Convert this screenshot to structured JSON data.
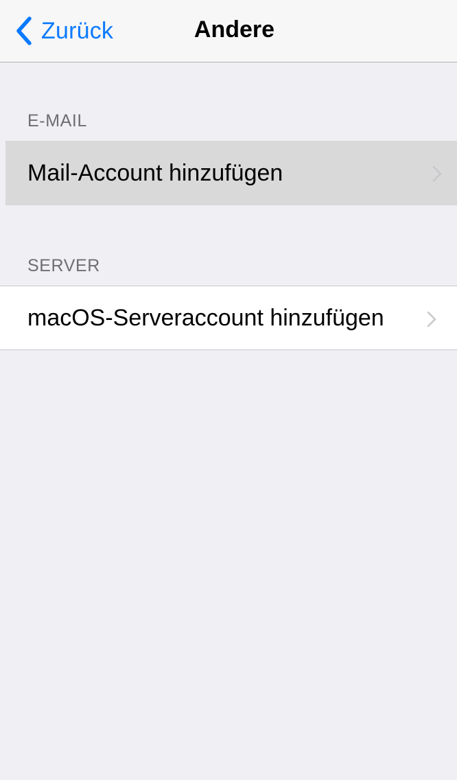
{
  "navbar": {
    "back_label": "Zurück",
    "title": "Andere"
  },
  "sections": [
    {
      "header": "E-MAIL",
      "rows": [
        {
          "label": "Mail-Account hinzufügen",
          "selected": true
        }
      ]
    },
    {
      "header": "SERVER",
      "rows": [
        {
          "label": "macOS-Serveraccount hinzufügen",
          "selected": false
        }
      ]
    }
  ],
  "icons": {
    "back": "chevron-left-icon",
    "disclosure": "chevron-right-icon"
  },
  "colors": {
    "accent": "#0a7aff",
    "background": "#efeff4",
    "navbar": "#f7f7f7",
    "selected_row": "#d9d9d9",
    "section_header_text": "#6d6d72",
    "chevron": "#c7c7cc"
  }
}
